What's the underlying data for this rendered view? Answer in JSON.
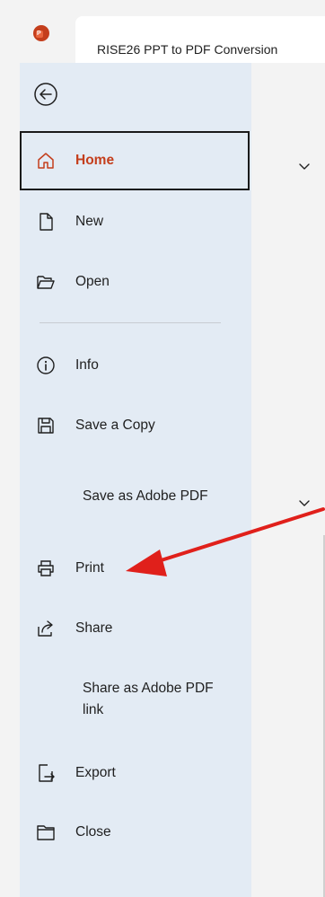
{
  "window": {
    "document_title": "RISE26 PPT to PDF Conversion"
  },
  "nav": {
    "items": [
      {
        "label": "Home"
      },
      {
        "label": "New"
      },
      {
        "label": "Open"
      },
      {
        "label": "Info"
      },
      {
        "label": "Save a Copy"
      },
      {
        "label": "Save as Adobe PDF"
      },
      {
        "label": "Print"
      },
      {
        "label": "Share"
      },
      {
        "label": "Share as Adobe PDF link"
      },
      {
        "label": "Export"
      },
      {
        "label": "Close"
      }
    ]
  },
  "colors": {
    "nav_background": "#e3ebf4",
    "accent": "#c43e1c",
    "annotation_arrow": "#e0201b"
  },
  "icons": [
    "powerpoint-logo-icon",
    "back-arrow-icon",
    "home-icon",
    "new-file-icon",
    "open-folder-icon",
    "info-icon",
    "save-icon",
    "print-icon",
    "share-icon",
    "export-icon",
    "close-folder-icon",
    "chevron-down-icon"
  ]
}
